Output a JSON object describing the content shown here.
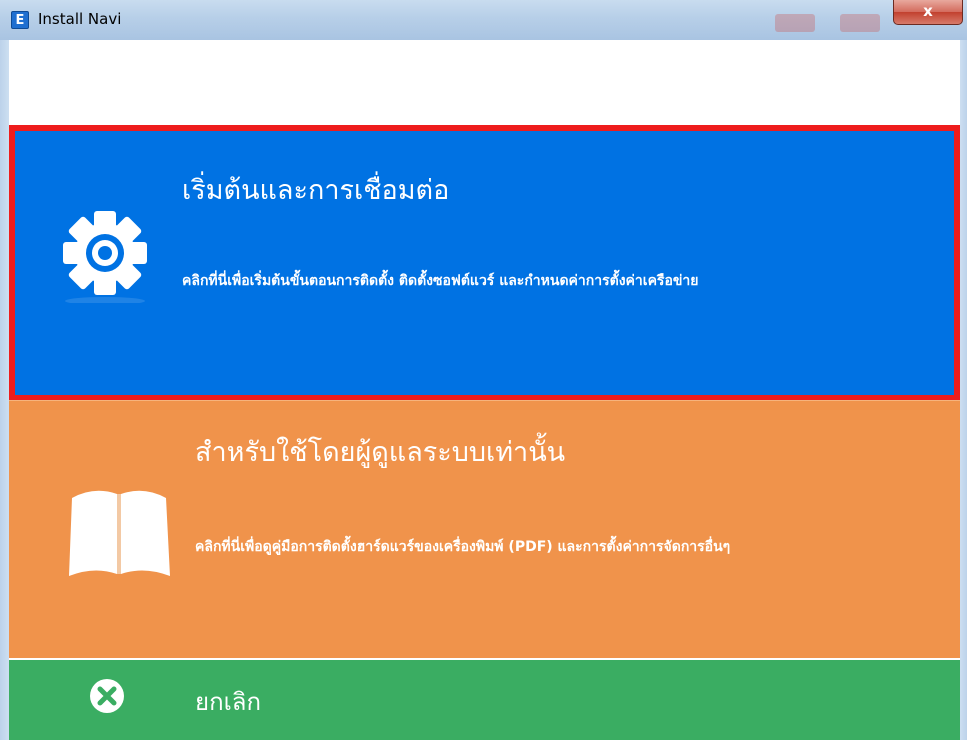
{
  "window": {
    "title": "Install Navi",
    "app_icon_letter": "E",
    "close_label": "x"
  },
  "panels": {
    "start": {
      "title": "เริ่มต้นและการเชื่อมต่อ",
      "description": "คลิกที่นี่เพื่อเริ่มต้นขั้นตอนการติดตั้ง ติดตั้งซอฟต์แวร์ และกำหนดค่าการตั้งค่าเครือข่าย",
      "icon": "gear-icon",
      "color": "#0072e3",
      "highlight_color": "#ee1c1c"
    },
    "admin": {
      "title": "สำหรับใช้โดยผู้ดูแลระบบเท่านั้น",
      "description": "คลิกที่นี่เพื่อดูคู่มือการติดตั้งฮาร์ดแวร์ของเครื่องพิมพ์ (PDF) และการตั้งค่าการจัดการอื่นๆ",
      "icon": "book-icon",
      "color": "#f0934b"
    },
    "cancel": {
      "title": "ยกเลิก",
      "icon": "cancel-icon",
      "color": "#3aad62"
    }
  }
}
